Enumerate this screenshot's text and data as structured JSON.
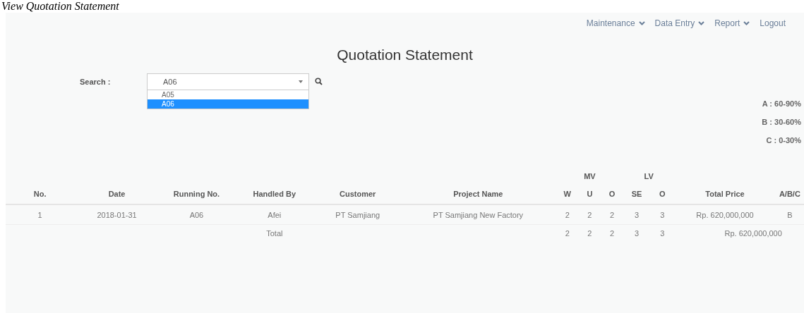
{
  "page_title": "View Quotation Statement",
  "nav": [
    {
      "label": "Maintenance",
      "dropdown": true
    },
    {
      "label": "Data Entry",
      "dropdown": true
    },
    {
      "label": "Report",
      "dropdown": true
    },
    {
      "label": "Logout",
      "dropdown": false
    }
  ],
  "heading": "Quotation Statement",
  "search": {
    "label": "Search :",
    "value": "A06",
    "options": [
      {
        "label": "A05",
        "selected": false
      },
      {
        "label": "A06",
        "selected": true
      }
    ]
  },
  "legend": [
    "A : 60-90%",
    "B : 30-60%",
    "C : 0-30%"
  ],
  "table": {
    "groups": [
      {
        "label": "MV"
      },
      {
        "label": "LV"
      }
    ],
    "columns": [
      "No.",
      "Date",
      "Running No.",
      "Handled By",
      "Customer",
      "Project Name",
      "W",
      "U",
      "O",
      "SE",
      "O",
      "Total Price",
      "A/B/C"
    ],
    "rows": [
      [
        "1",
        "2018-01-31",
        "A06",
        "Afei",
        "PT Samjiang",
        "PT Samjiang New Factory",
        "2",
        "2",
        "2",
        "3",
        "3",
        "Rp. 620,000,000",
        "B"
      ]
    ],
    "total": {
      "label": "Total",
      "values": [
        "2",
        "2",
        "2",
        "3",
        "3"
      ],
      "price": "Rp. 620,000,000"
    }
  }
}
